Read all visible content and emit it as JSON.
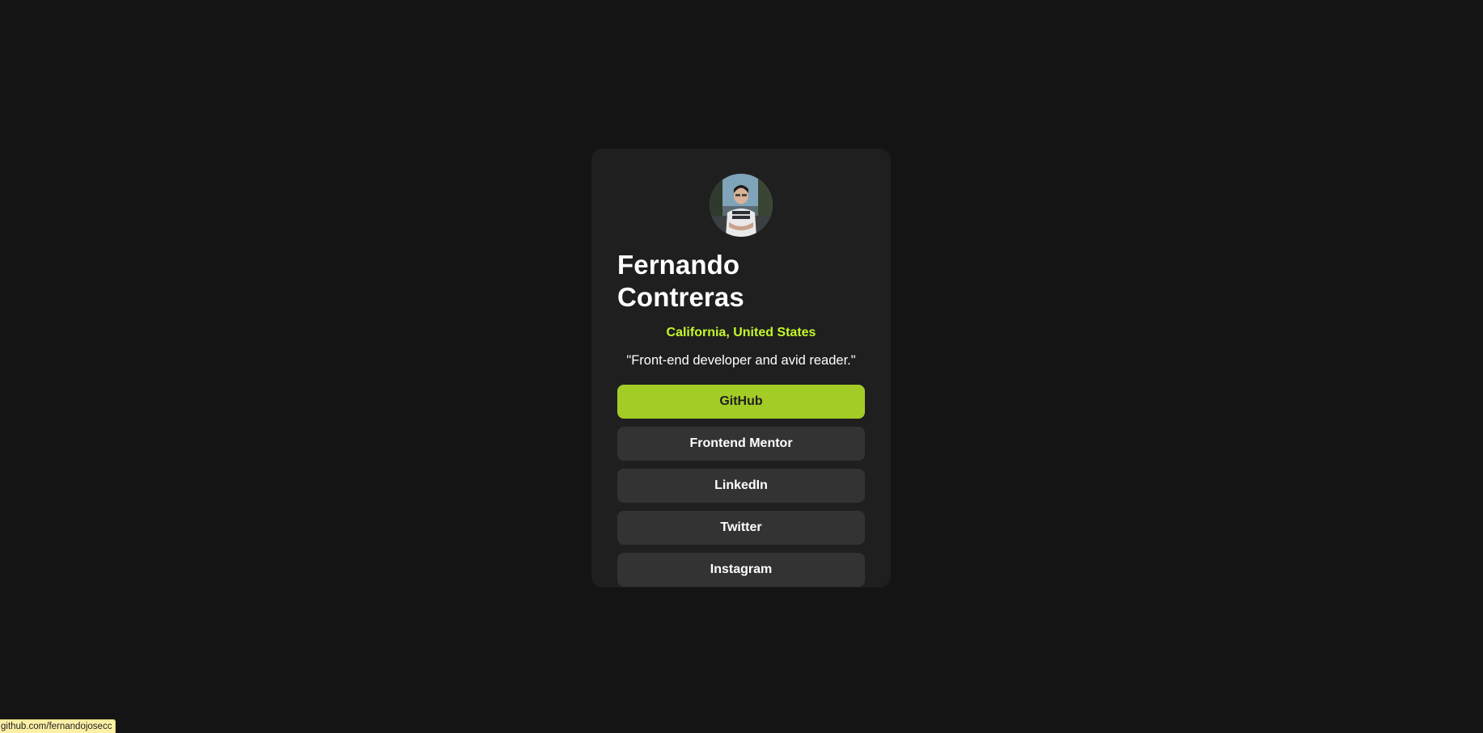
{
  "profile": {
    "name": "Fernando Contreras",
    "location": "California, United States",
    "bio": "\"Front-end developer and avid reader.\"",
    "avatar_icon": "profile-photo"
  },
  "links": [
    {
      "label": "GitHub",
      "active": true
    },
    {
      "label": "Frontend Mentor",
      "active": false
    },
    {
      "label": "LinkedIn",
      "active": false
    },
    {
      "label": "Twitter",
      "active": false
    },
    {
      "label": "Instagram",
      "active": false
    }
  ],
  "status_bar": {
    "url": "github.com/fernandojosecc"
  },
  "colors": {
    "background": "#141414",
    "card": "#1f1f1f",
    "accent": "#c4f82a",
    "button": "#333333",
    "button_active": "#a3cc27"
  }
}
